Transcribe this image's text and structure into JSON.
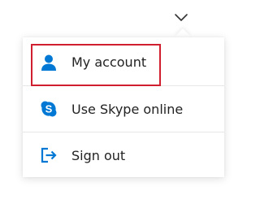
{
  "header": {
    "dropdown_icon": "chevron-down-icon"
  },
  "menu": {
    "items": [
      {
        "label": "My account",
        "icon": "person-icon",
        "highlighted": true
      },
      {
        "label": "Use Skype online",
        "icon": "skype-icon",
        "highlighted": false
      },
      {
        "label": "Sign out",
        "icon": "sign-out-icon",
        "highlighted": false
      }
    ]
  },
  "colors": {
    "accent": "#0078d4",
    "highlight_border": "#d01f2e",
    "text": "#222222",
    "divider": "#e7e7e7"
  }
}
